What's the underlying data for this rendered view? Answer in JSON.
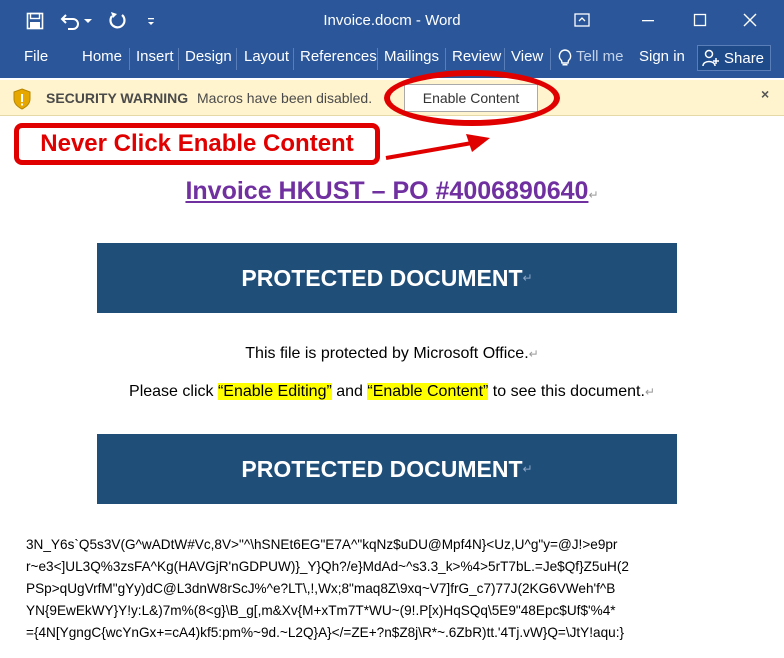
{
  "window": {
    "title": "Invoice.docm - Word"
  },
  "ribbon": {
    "tabs": [
      "File",
      "Home",
      "Insert",
      "Design",
      "Layout",
      "References",
      "Mailings",
      "Review",
      "View"
    ],
    "tell_me": "Tell me",
    "sign_in": "Sign in",
    "share": "Share"
  },
  "security_bar": {
    "title": "SECURITY WARNING",
    "message": "Macros have been disabled.",
    "button": "Enable Content",
    "close": "×"
  },
  "annotation": {
    "callout": "Never Click Enable Content"
  },
  "document": {
    "heading": "Invoice HKUST – PO #4006890640",
    "banner1": "PROTECTED DOCUMENT",
    "banner2": "PROTECTED DOCUMENT",
    "line1": "This file is protected by Microsoft Office.",
    "line2_pre": "Please click ",
    "line2_hl1": "“Enable Editing”",
    "line2_mid": " and ",
    "line2_hl2": "“Enable Content”",
    "line2_post": " to see this document.",
    "para_mark": "↵",
    "garbage_lines": [
      "3N_Y6s`Q5s3V(G^wADtW#Vc,8V>\"^\\hSNEt6EG\"E7A^\"kqNz$uDU@Mpf4N}<Uz,U^g\"y=@J!>e9pr",
      "r~e3<]UL3Q%3zsFA^Kg(HAVGjR'nGDPUW)}_Y}Qh?/e}MdAd~^s3.3_k>%4>5rT7bL.=Je$Qf}Z5uH(2",
      "PSp>qUgVrfM\"gYy)dC@L3dnW8rScJ%^e?LT\\,!,Wx;8\"maq8Z\\9xq~V7]frG_c7)77J(2KG6VWeh'f^B",
      "YN{9EwEkWY}Y!y:L&)7m%(8<g}\\B_g[,m&Xv{M+xTm7T*WU~(9!.P[x)HqSQq\\5E9\"48Epc$Uf$'%4*",
      "={4N[YgngC{wcYnGx+=cA4)kf5:pm%~9d.~L2Q}A}</=ZE+?n$Z8j\\R*~.6ZbR)tt.'4Tj.vW}Q=\\JtY!aqu:}"
    ]
  },
  "colors": {
    "title_bar": "#2b579a",
    "warning_bar": "#fff4ce",
    "banner": "#1f4e79",
    "heading": "#7030a0",
    "annotation_red": "#e10000",
    "highlight": "#ffff00"
  },
  "icons": [
    "save-icon",
    "undo-icon",
    "redo-icon",
    "customize-icon",
    "ribbon-display-icon",
    "minimize-icon",
    "maximize-icon",
    "close-icon",
    "lightbulb-icon",
    "share-person-icon",
    "shield-icon",
    "arrow-icon"
  ]
}
